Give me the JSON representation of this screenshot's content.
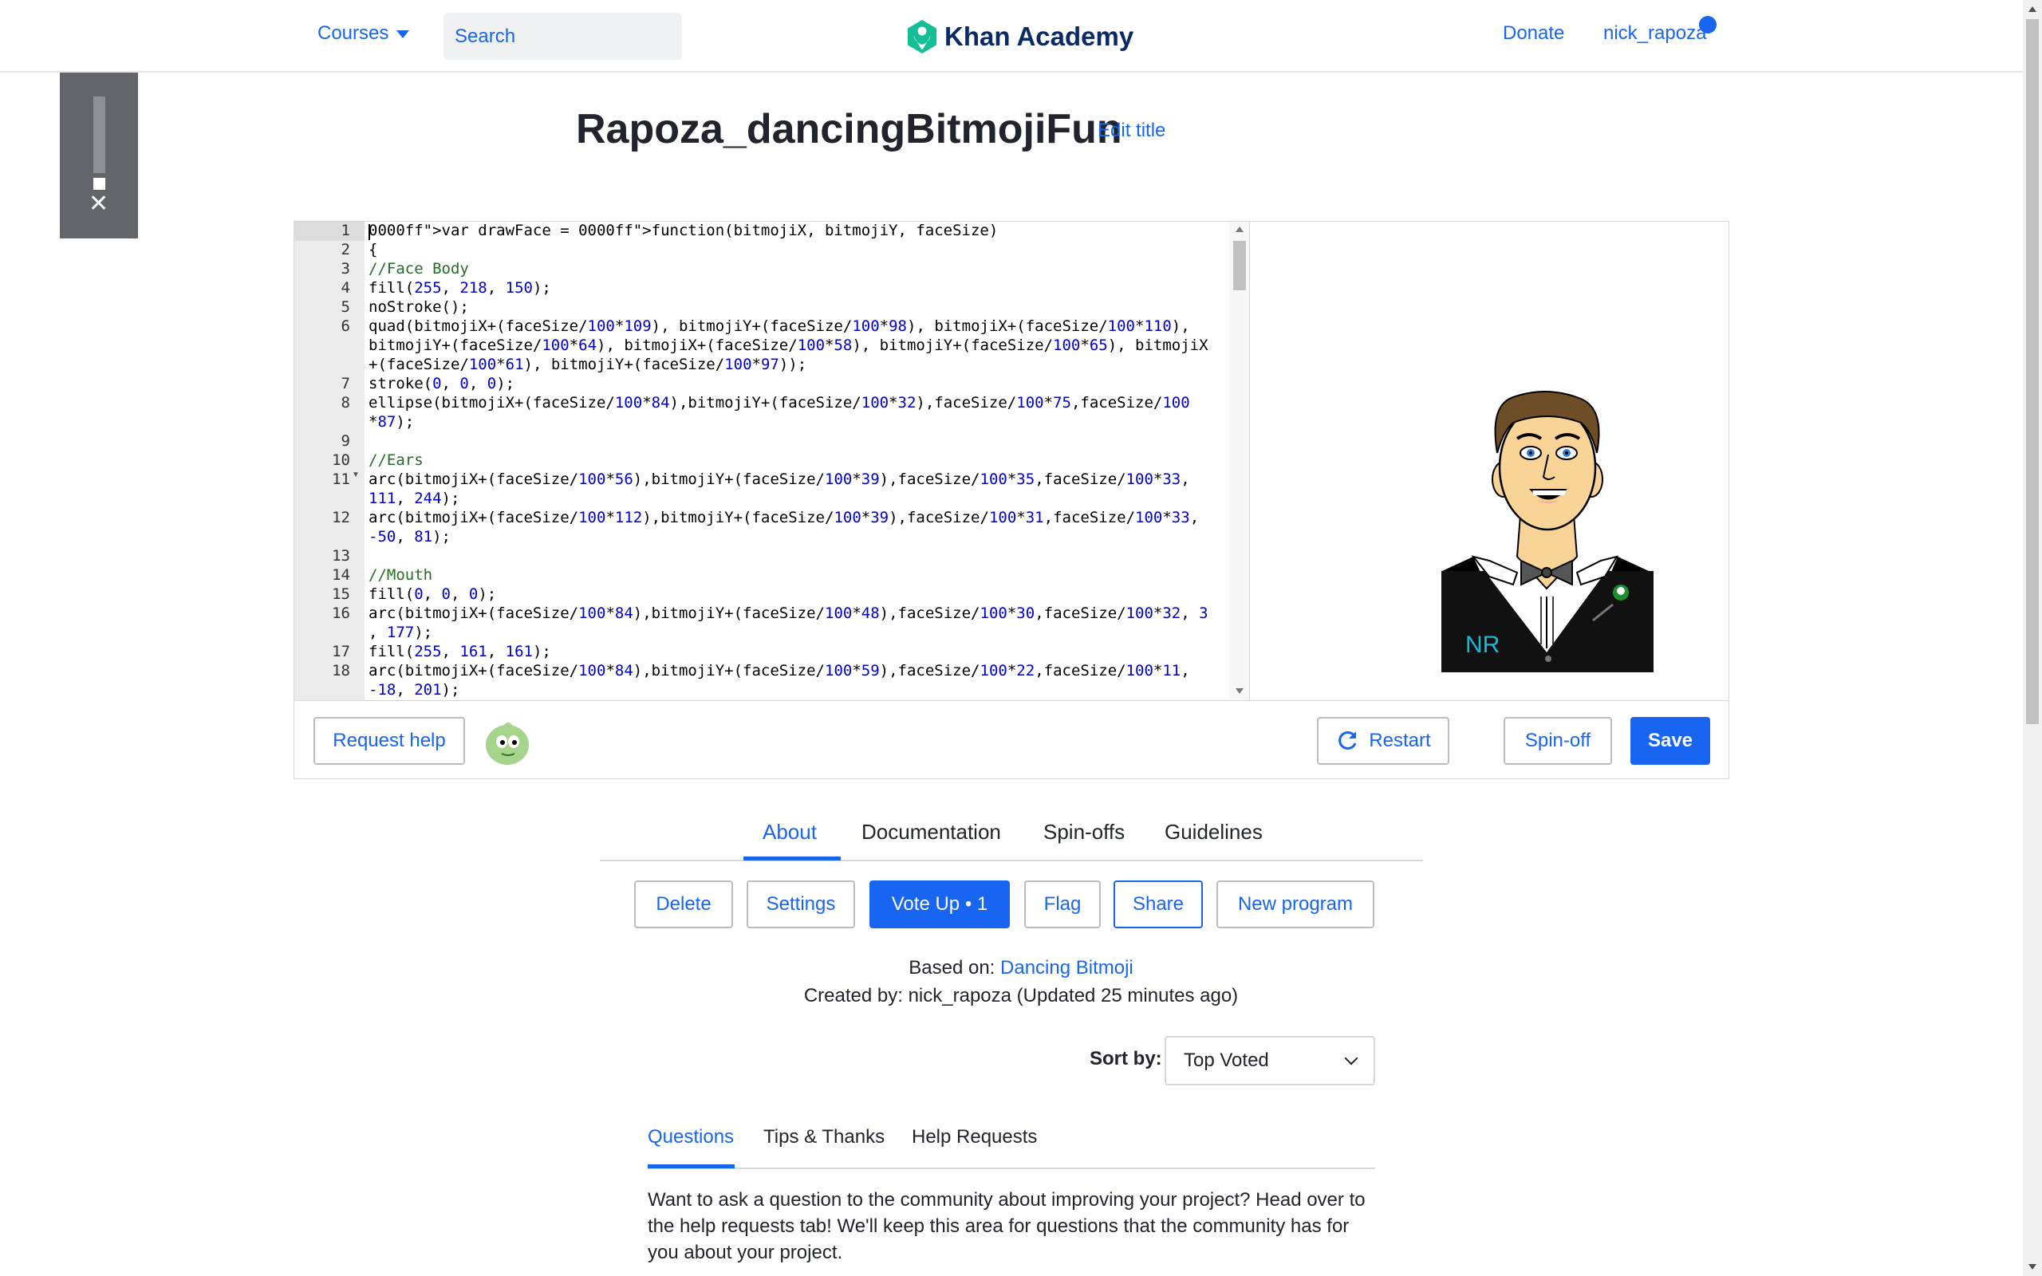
{
  "header": {
    "courses_label": "Courses",
    "search_placeholder": "Search",
    "logo_text": "Khan Academy",
    "donate_label": "Donate",
    "username": "nick_rapoza"
  },
  "program": {
    "title": "Rapoza_dancingBitmojiFun",
    "edit_title_label": "Edit title"
  },
  "editor": {
    "line_numbers": [
      "1",
      "2",
      "3",
      "4",
      "5",
      "6",
      "",
      "",
      "7",
      "8",
      "",
      "9",
      "10",
      "11",
      "",
      "12",
      "",
      "13",
      "14",
      "15",
      "16",
      "",
      "17",
      "18",
      ""
    ],
    "lines": [
      {
        "html": "var drawFace = function(bitmojiX, bitmojiY, faceSize)"
      },
      {
        "html": "{"
      },
      {
        "html": "//Face Body"
      },
      {
        "html": "fill(255, 218, 150);"
      },
      {
        "html": "noStroke();"
      },
      {
        "html": "quad(bitmojiX+(faceSize/100*109), bitmojiY+(faceSize/100*98), bitmojiX+(faceSize/100*110),"
      },
      {
        "html": "bitmojiY+(faceSize/100*64), bitmojiX+(faceSize/100*58), bitmojiY+(faceSize/100*65), bitmojiX"
      },
      {
        "html": "+(faceSize/100*61), bitmojiY+(faceSize/100*97));"
      },
      {
        "html": "stroke(0, 0, 0);"
      },
      {
        "html": "ellipse(bitmojiX+(faceSize/100*84),bitmojiY+(faceSize/100*32),faceSize/100*75,faceSize/100"
      },
      {
        "html": "*87);"
      },
      {
        "html": ""
      },
      {
        "html": "//Ears"
      },
      {
        "html": "arc(bitmojiX+(faceSize/100*56),bitmojiY+(faceSize/100*39),faceSize/100*35,faceSize/100*33,"
      },
      {
        "html": "111, 244);"
      },
      {
        "html": "arc(bitmojiX+(faceSize/100*112),bitmojiY+(faceSize/100*39),faceSize/100*31,faceSize/100*33,"
      },
      {
        "html": "-50, 81);"
      },
      {
        "html": ""
      },
      {
        "html": "//Mouth"
      },
      {
        "html": "fill(0, 0, 0);"
      },
      {
        "html": "arc(bitmojiX+(faceSize/100*84),bitmojiY+(faceSize/100*48),faceSize/100*30,faceSize/100*32, 3"
      },
      {
        "html": ", 177);"
      },
      {
        "html": "fill(255, 161, 161);"
      },
      {
        "html": "arc(bitmojiX+(faceSize/100*84),bitmojiY+(faceSize/100*59),faceSize/100*22,faceSize/100*11,"
      },
      {
        "html": "-18, 201);"
      }
    ]
  },
  "canvas": {
    "initials": "NR"
  },
  "toolbar": {
    "request_help_label": "Request help",
    "restart_label": "Restart",
    "spinoff_label": "Spin-off",
    "save_label": "Save"
  },
  "tabs": [
    "About",
    "Documentation",
    "Spin-offs",
    "Guidelines"
  ],
  "actions": {
    "delete_label": "Delete",
    "settings_label": "Settings",
    "vote_label": "Vote Up • 1",
    "flag_label": "Flag",
    "share_label": "Share",
    "new_program_label": "New program"
  },
  "meta": {
    "based_on_prefix": "Based on:",
    "based_on_link": "Dancing Bitmoji",
    "created_by": "Created by: nick_rapoza (Updated 25 minutes ago)"
  },
  "sort": {
    "label": "Sort by:",
    "value": "Top Voted"
  },
  "question_tabs": [
    "Questions",
    "Tips & Thanks",
    "Help Requests"
  ],
  "questions_text": "Want to ask a question to the community about improving your project? Head over to the help requests tab! We'll keep this area for questions that the community has for you about your project.",
  "colors": {
    "accent": "#1865f2",
    "logo_green": "#14bf96",
    "code_number": "#0000cd",
    "code_comment": "#236e24",
    "code_keyword": "#0000ff"
  }
}
